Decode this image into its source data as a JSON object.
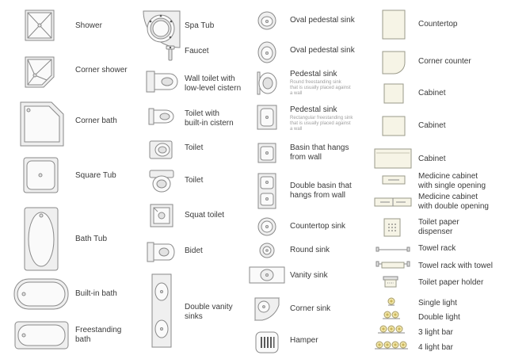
{
  "symbols": [
    {
      "id": "shower",
      "label": "Shower"
    },
    {
      "id": "corner-shower",
      "label": "Corner shower"
    },
    {
      "id": "corner-bath",
      "label": "Corner bath"
    },
    {
      "id": "square-tub",
      "label": "Square Tub"
    },
    {
      "id": "bath-tub",
      "label": "Bath Tub"
    },
    {
      "id": "built-in-bath",
      "label": "Built-in bath"
    },
    {
      "id": "freestanding-bath",
      "label": "Freestanding\nbath"
    },
    {
      "id": "spa-tub",
      "label": "Spa Tub"
    },
    {
      "id": "faucet",
      "label": "Faucet"
    },
    {
      "id": "wall-toilet",
      "label": "Wall toilet with\nlow-level cistern"
    },
    {
      "id": "toilet-built-in-cistern",
      "label": "Toilet with\nbuilt-in cistern"
    },
    {
      "id": "toilet-1",
      "label": "Toilet"
    },
    {
      "id": "toilet-2",
      "label": "Toilet"
    },
    {
      "id": "squat-toilet",
      "label": "Squat toilet"
    },
    {
      "id": "bidet",
      "label": "Bidet"
    },
    {
      "id": "double-vanity-sinks",
      "label": "Double vanity\nsinks"
    },
    {
      "id": "oval-pedestal-sink-1",
      "label": "Oval pedestal sink"
    },
    {
      "id": "oval-pedestal-sink-2",
      "label": "Oval pedestal sink"
    },
    {
      "id": "pedestal-sink-round",
      "label": "Pedestal sink",
      "note": "Round freestanding sink\nthat is usually placed against\na wall"
    },
    {
      "id": "pedestal-sink-rect",
      "label": "Pedestal sink",
      "note": "Rectangular freestanding sink\nthat is usually placed against\na wall"
    },
    {
      "id": "basin-hangs",
      "label": "Basin that hangs\nfrom wall"
    },
    {
      "id": "double-basin-hangs",
      "label": "Double basin that\nhangs from wall"
    },
    {
      "id": "countertop-sink",
      "label": "Countertop sink"
    },
    {
      "id": "round-sink",
      "label": "Round sink"
    },
    {
      "id": "vanity-sink",
      "label": "Vanity sink"
    },
    {
      "id": "corner-sink",
      "label": "Corner sink"
    },
    {
      "id": "hamper",
      "label": "Hamper"
    },
    {
      "id": "countertop",
      "label": "Countertop"
    },
    {
      "id": "corner-counter",
      "label": "Corner counter"
    },
    {
      "id": "cabinet-1",
      "label": "Cabinet"
    },
    {
      "id": "cabinet-2",
      "label": "Cabinet"
    },
    {
      "id": "cabinet-3",
      "label": "Cabinet"
    },
    {
      "id": "medicine-cabinet-single",
      "label": "Medicine cabinet\nwith single opening"
    },
    {
      "id": "medicine-cabinet-double",
      "label": "Medicine cabinet\nwith double opening"
    },
    {
      "id": "toilet-paper-dispenser",
      "label": "Toilet paper\ndispenser"
    },
    {
      "id": "towel-rack",
      "label": "Towel rack"
    },
    {
      "id": "towel-rack-with-towel",
      "label": "Towel rack with towel"
    },
    {
      "id": "toilet-paper-holder",
      "label": "Toilet paper holder"
    },
    {
      "id": "single-light",
      "label": "Single light"
    },
    {
      "id": "double-light",
      "label": "Double light"
    },
    {
      "id": "3-light-bar",
      "label": "3 light bar"
    },
    {
      "id": "4-light-bar",
      "label": "4 light bar"
    }
  ]
}
